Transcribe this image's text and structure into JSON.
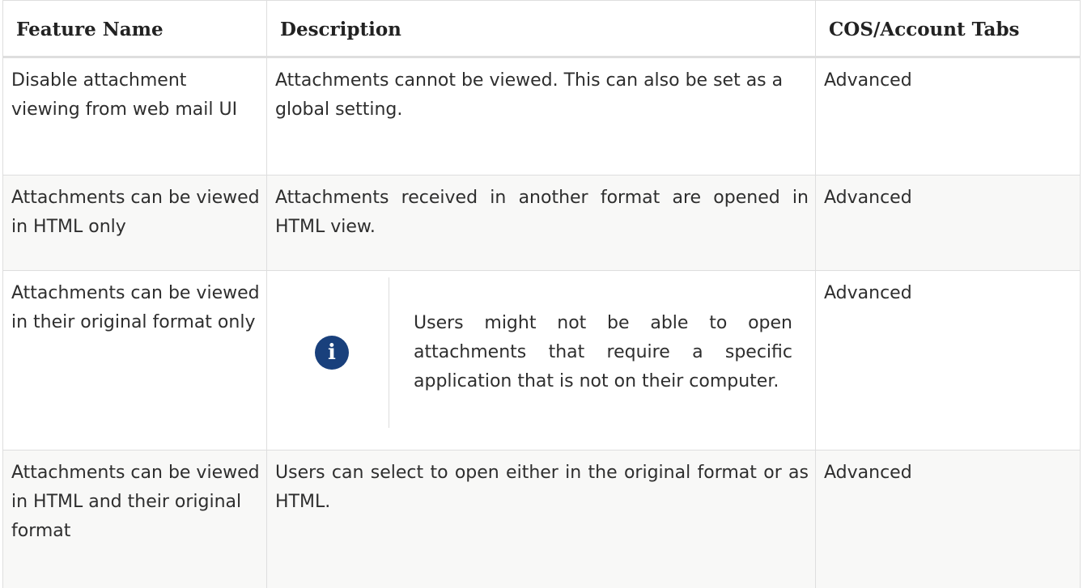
{
  "table": {
    "headers": [
      "Feature Name",
      "Description",
      "COS/Account Tabs"
    ],
    "rows": [
      {
        "feature": "Disable attachment viewing from web mail UI",
        "description": "Attachments cannot be viewed. This can also be set as a global setting.",
        "tab": "Advanced"
      },
      {
        "feature": "Attachments can be viewed in HTML only",
        "description": "Attachments received in another format are opened in HTML view.",
        "tab": "Advanced"
      },
      {
        "feature": "Attachments can be viewed in their original format only",
        "note": {
          "icon": "info-icon",
          "icon_glyph": "i",
          "icon_color": "#19407c",
          "text": "Users might not be able to open attachments that require a specific application that is not on their computer."
        },
        "tab": "Advanced"
      },
      {
        "feature": "Attachments can be viewed in HTML and their original format",
        "description": "Users can select to open either in the original format or as HTML.",
        "tab": "Advanced"
      }
    ]
  }
}
